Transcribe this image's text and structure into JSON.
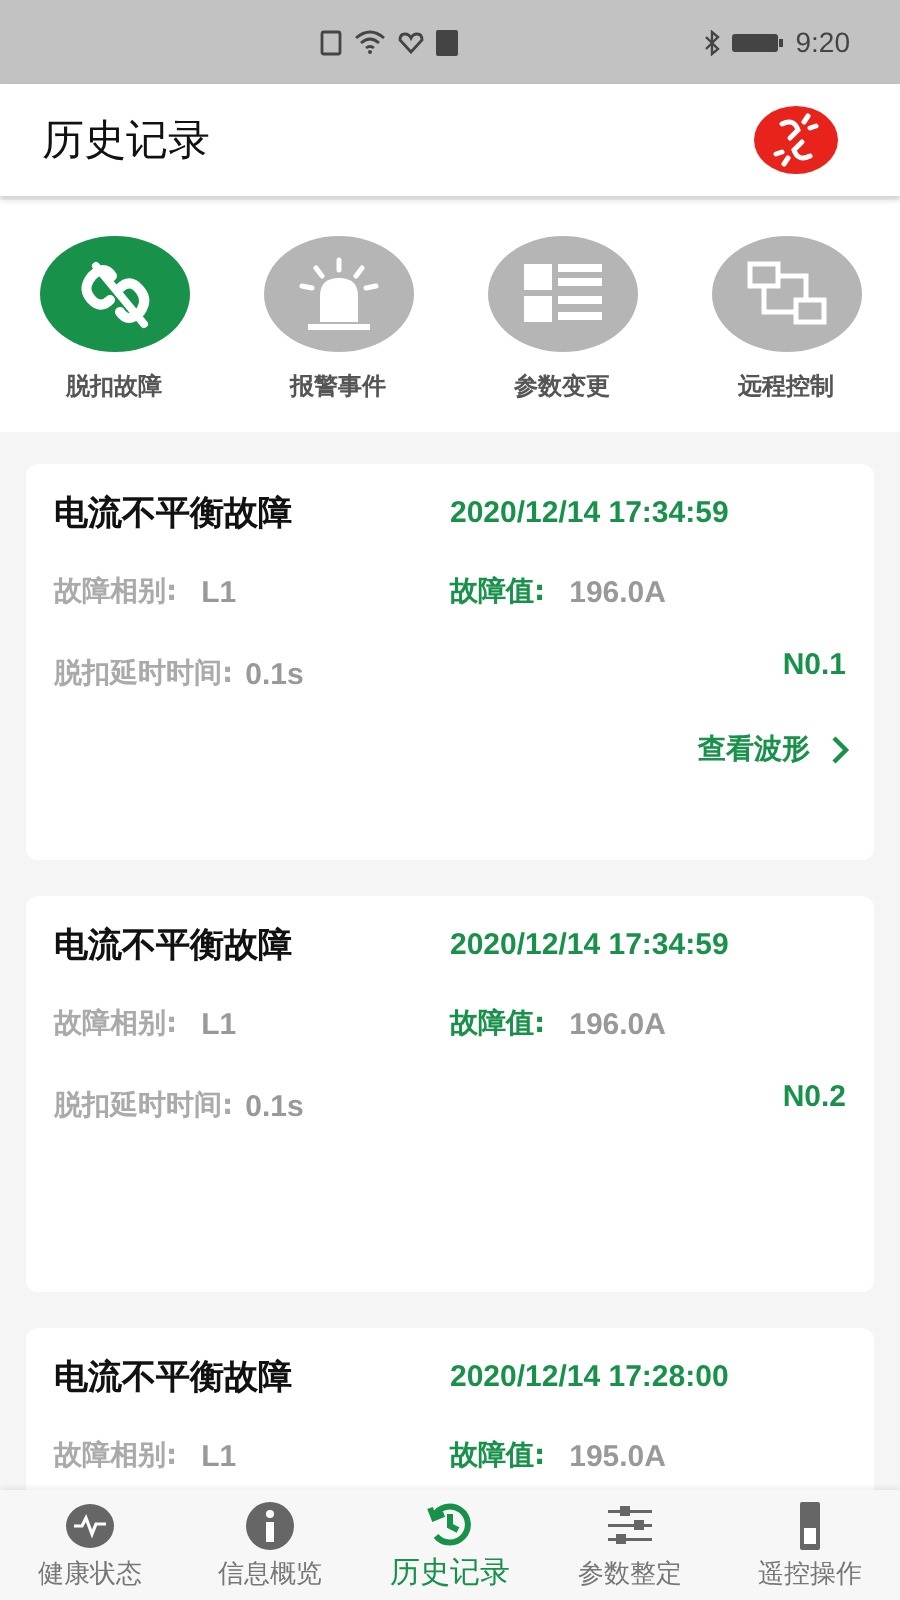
{
  "status_bar": {
    "time": "9:20"
  },
  "header": {
    "title": "历史记录"
  },
  "categories": [
    {
      "label": "脱扣故障",
      "kind": "unlink",
      "selected": true
    },
    {
      "label": "报警事件",
      "kind": "alarm",
      "selected": false
    },
    {
      "label": "参数变更",
      "kind": "grid",
      "selected": false
    },
    {
      "label": "远程控制",
      "kind": "flow",
      "selected": false
    }
  ],
  "records": [
    {
      "title": "电流不平衡故障",
      "time": "2020/12/14 17:34:59",
      "phase_label": "故障相别:",
      "phase": "L1",
      "value_label": "故障值:",
      "value": "196.0A",
      "delay_label": "脱扣延时时间:",
      "delay": "0.1s",
      "no": "N0.1",
      "link": "查看波形"
    },
    {
      "title": "电流不平衡故障",
      "time": "2020/12/14 17:34:59",
      "phase_label": "故障相别:",
      "phase": "L1",
      "value_label": "故障值:",
      "value": "196.0A",
      "delay_label": "脱扣延时时间:",
      "delay": "0.1s",
      "no": "N0.2"
    },
    {
      "title": "电流不平衡故障",
      "time": "2020/12/14 17:28:00",
      "phase_label": "故障相别:",
      "phase": "L1",
      "value_label": "故障值:",
      "value": "195.0A"
    }
  ],
  "nav": [
    {
      "label": "健康状态",
      "kind": "heart",
      "selected": false
    },
    {
      "label": "信息概览",
      "kind": "info",
      "selected": false
    },
    {
      "label": "历史记录",
      "kind": "history",
      "selected": true
    },
    {
      "label": "参数整定",
      "kind": "sliders",
      "selected": false
    },
    {
      "label": "遥控操作",
      "kind": "switch",
      "selected": false
    }
  ]
}
